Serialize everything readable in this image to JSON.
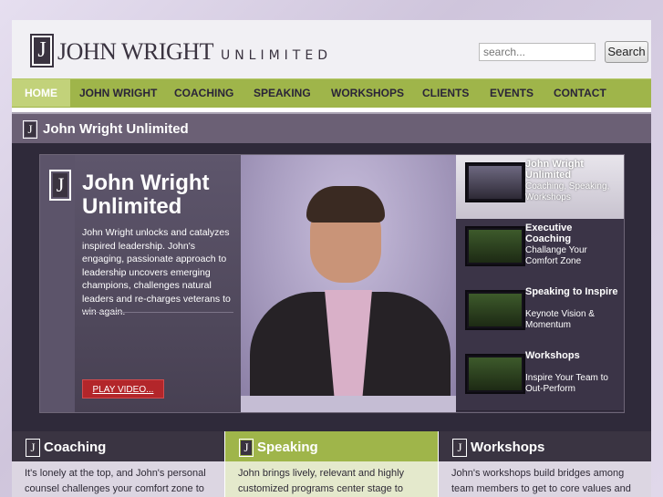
{
  "brand": {
    "logo_letter": "J",
    "name": "JOHN WRIGHT",
    "tagline": "UNLIMITED"
  },
  "search": {
    "placeholder": "search...",
    "button_label": "Search"
  },
  "nav": {
    "items": [
      "HOME",
      "JOHN WRIGHT",
      "COACHING",
      "SPEAKING",
      "WORKSHOPS",
      "CLIENTS",
      "EVENTS",
      "CONTACT"
    ]
  },
  "titlebar": {
    "title": "John Wright Unlimited"
  },
  "hero": {
    "title": "John Wright Unlimited",
    "description": "John Wright unlocks and catalyzes inspired leadership. John's engaging, passionate approach to leadership uncovers emerging champions, challenges natural leaders and re-charges veterans to win again.",
    "play_label": "PLAY VIDEO..."
  },
  "side_items": [
    {
      "title": "John Wright Unlimited",
      "subtitle": "Coaching, Speaking, Workshops"
    },
    {
      "title": "Executive Coaching",
      "subtitle": "Challange Your Comfort Zone"
    },
    {
      "title": "Speaking to Inspire",
      "subtitle": "Keynote Vision & Momentum"
    },
    {
      "title": "Workshops",
      "subtitle": "Inspire Your Team to Out-Perform"
    }
  ],
  "columns": [
    {
      "title": "Coaching",
      "text": "It's lonely at the top, and John's personal counsel challenges your comfort zone to"
    },
    {
      "title": "Speaking",
      "text": "John brings lively, relevant and highly customized programs center stage to"
    },
    {
      "title": "Workshops",
      "text": "John's workshops build bridges among team members to get to core values and"
    }
  ],
  "colors": {
    "nav_green": "#9fb54a",
    "nav_active": "#c2d27a",
    "dark_purple": "#2f2a3a",
    "accent_red": "#b3262a"
  }
}
